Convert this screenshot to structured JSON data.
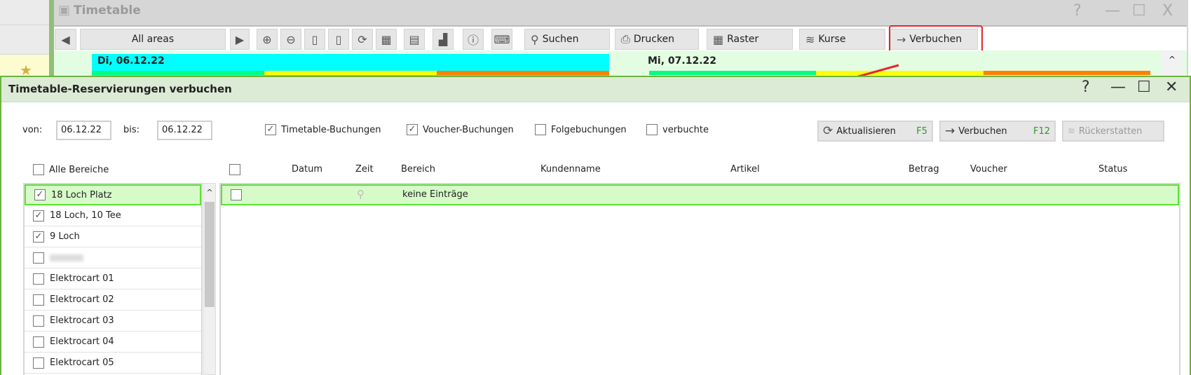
{
  "background_window": {
    "title": "Timetable",
    "controls": [
      "?",
      "—",
      "☐",
      "X"
    ],
    "toolbar": {
      "area_selector": "All areas",
      "search": "Suchen",
      "print": "Drucken",
      "grid": "Raster",
      "courses": "Kurse",
      "book": "Verbuchen"
    },
    "days": [
      {
        "label": "Di, 06.12.22",
        "color": "#00ffff"
      },
      {
        "label": "Mi, 07.12.22",
        "color": "#e3fde3"
      }
    ],
    "occupancy_colors": [
      "#00ff80",
      "#ffff00",
      "#ff8000"
    ]
  },
  "dialog": {
    "title": "Timetable-Reservierungen verbuchen",
    "controls": [
      "?",
      "—",
      "☐",
      "✕"
    ],
    "from_label": "von:",
    "from_value": "06.12.22",
    "to_label": "bis:",
    "to_value": "06.12.22",
    "filters": [
      {
        "label": "Timetable-Buchungen",
        "checked": true
      },
      {
        "label": "Voucher-Buchungen",
        "checked": true
      },
      {
        "label": "Folgebuchungen",
        "checked": false
      },
      {
        "label": "verbuchte",
        "checked": false
      }
    ],
    "buttons": {
      "refresh": "Aktualisieren",
      "refresh_key": "F5",
      "book": "Verbuchen",
      "book_key": "F12",
      "refund": "Rückerstatten"
    },
    "all_areas_label": "Alle Bereiche",
    "areas": [
      {
        "label": "18 Loch Platz",
        "checked": true
      },
      {
        "label": "18 Loch, 10 Tee",
        "checked": true
      },
      {
        "label": "9 Loch",
        "checked": true
      },
      {
        "label": "",
        "checked": false
      },
      {
        "label": "Elektrocart 01",
        "checked": false
      },
      {
        "label": "Elektrocart 02",
        "checked": false
      },
      {
        "label": "Elektrocart 03",
        "checked": false
      },
      {
        "label": "Elektrocart 04",
        "checked": false
      },
      {
        "label": "Elektrocart 05",
        "checked": false
      }
    ],
    "columns": {
      "date": "Datum",
      "time": "Zeit",
      "area": "Bereich",
      "customer": "Kundenname",
      "article": "Artikel",
      "amount": "Betrag",
      "voucher": "Voucher",
      "status": "Status"
    },
    "empty_text": "keine Einträge"
  }
}
